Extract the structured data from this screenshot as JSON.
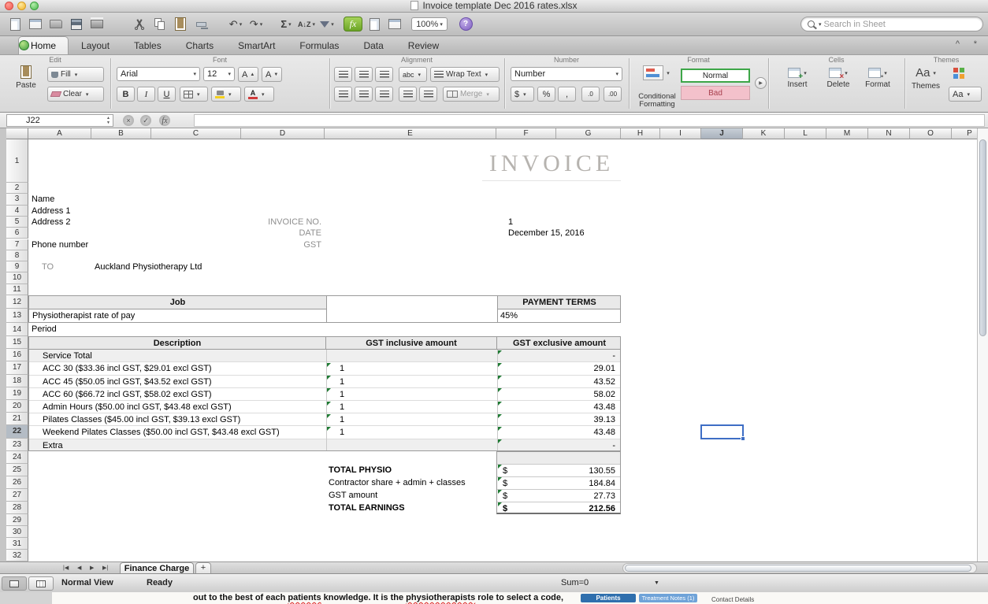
{
  "window": {
    "title": "Invoice template Dec 2016 rates.xlsx"
  },
  "toolbar": {
    "zoom": "100%",
    "fx": "fx",
    "search_placeholder": "Search in Sheet"
  },
  "ribbon": {
    "tabs": [
      "Home",
      "Layout",
      "Tables",
      "Charts",
      "SmartArt",
      "Formulas",
      "Data",
      "Review"
    ],
    "active_tab": "Home",
    "edit": {
      "label": "Edit",
      "paste": "Paste",
      "fill": "Fill",
      "clear": "Clear"
    },
    "font": {
      "label": "Font",
      "family": "Arial",
      "size": "12",
      "bold": "B",
      "italic": "I",
      "underline": "U"
    },
    "alignment": {
      "label": "Alignment",
      "abc": "abc",
      "wrap_text": "Wrap Text",
      "merge": "Merge"
    },
    "number": {
      "label": "Number",
      "format": "Number",
      "currency": "$",
      "percent": "%",
      "comma": ",",
      "inc": ".0",
      "dec": ".00"
    },
    "format": {
      "label": "Format",
      "conditional_line1": "Conditional",
      "conditional_line2": "Formatting",
      "style_normal": "Normal",
      "style_bad": "Bad"
    },
    "cells": {
      "label": "Cells",
      "insert": "Insert",
      "delete": "Delete",
      "format": "Format"
    },
    "themes": {
      "label": "Themes",
      "themes": "Themes",
      "aa": "Aa"
    }
  },
  "formula_bar": {
    "name_box": "J22",
    "fx": "fx"
  },
  "grid": {
    "columns": [
      "A",
      "B",
      "C",
      "D",
      "E",
      "F",
      "G",
      "H",
      "I",
      "J",
      "K",
      "L",
      "M",
      "N",
      "O",
      "P"
    ],
    "row_count": 32,
    "selected_cell": "J22",
    "selected_column": "J",
    "selected_row": 22
  },
  "invoice": {
    "title": "INVOICE",
    "name": "Name",
    "address1": "Address 1",
    "address2": "Address 2",
    "phone": "Phone number",
    "invoice_no_label": "INVOICE NO.",
    "date_label": "DATE",
    "gst_label": "GST",
    "invoice_no": "1",
    "date": "December 15, 2016",
    "to_label": "TO",
    "to_name": "Auckland Physiotherapy Ltd",
    "job_header": "Job",
    "payment_terms": "PAYMENT TERMS",
    "rate_label": "Physiotherapist rate of pay",
    "rate_value": "45%",
    "period": "Period",
    "col_description": "Description",
    "col_inclusive": "GST inclusive amount",
    "col_exclusive": "GST exclusive amount",
    "items": [
      {
        "desc": "Service Total",
        "qty": "",
        "amount": "-"
      },
      {
        "desc": "ACC 30 ($33.36 incl GST, $29.01 excl GST)",
        "qty": "1",
        "amount": "29.01"
      },
      {
        "desc": "ACC 45 ($50.05 incl GST, $43.52 excl GST)",
        "qty": "1",
        "amount": "43.52"
      },
      {
        "desc": "ACC 60 ($66.72 incl GST, $58.02 excl GST)",
        "qty": "1",
        "amount": "58.02"
      },
      {
        "desc": "Admin Hours ($50.00 incl GST, $43.48 excl GST)",
        "qty": "1",
        "amount": "43.48"
      },
      {
        "desc": "Pilates Classes ($45.00 incl GST, $39.13 excl GST)",
        "qty": "1",
        "amount": "39.13"
      },
      {
        "desc": "Weekend Pilates Classes ($50.00 incl GST, $43.48 excl GST)",
        "qty": "1",
        "amount": "43.48"
      },
      {
        "desc": "Extra",
        "qty": "",
        "amount": "-"
      }
    ],
    "totals": [
      {
        "label": "TOTAL PHYSIO",
        "currency": "$",
        "amount": "130.55"
      },
      {
        "label": "Contractor share + admin + classes",
        "currency": "$",
        "amount": "184.84"
      },
      {
        "label": "GST amount",
        "currency": "$",
        "amount": "27.73"
      },
      {
        "label": "TOTAL EARNINGS",
        "currency": "$",
        "amount": "212.56"
      }
    ]
  },
  "sheet_tabs": {
    "active": "Finance Charge",
    "add": "+"
  },
  "status_bar": {
    "view": "Normal View",
    "state": "Ready",
    "sum": "Sum=0"
  },
  "background_window": {
    "text_before": "out to the best of each ",
    "misspelled_1": "patients",
    "text_mid": " knowledge. It is the ",
    "misspelled_2": "physiotherapists",
    "text_after": " role to select a code,",
    "tab1": "Patients",
    "tab2": "Treatment Notes (1)",
    "link": "Contact Details"
  }
}
